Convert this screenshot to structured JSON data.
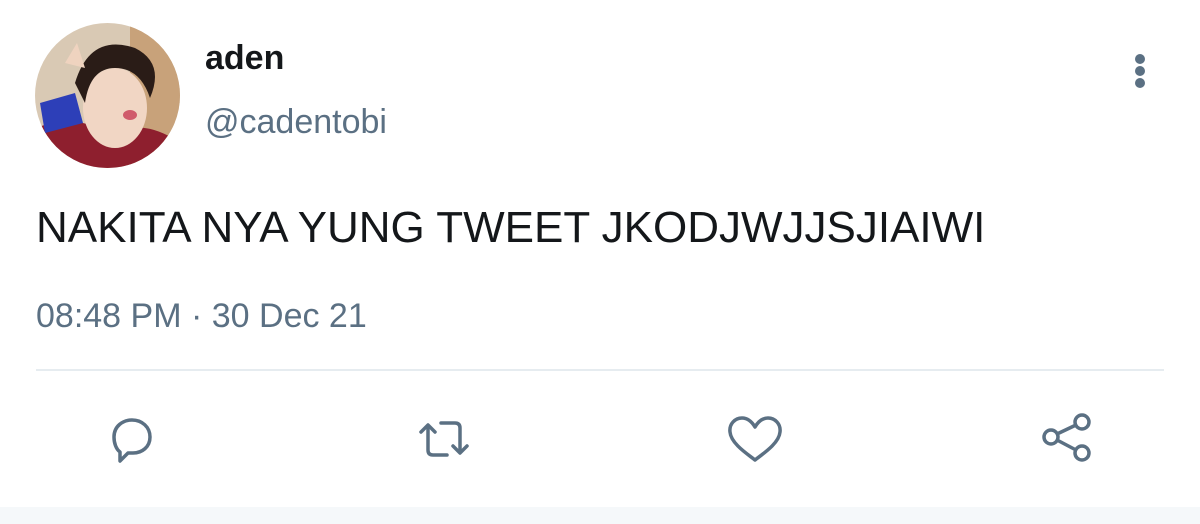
{
  "user": {
    "display_name": "aden",
    "handle": "@cadentobi"
  },
  "tweet": {
    "text": "NAKITA NYA YUNG TWEET JKODJWJJSJIAIWI",
    "time": "08:48 PM",
    "separator": " · ",
    "date": "30 Dec 21"
  },
  "actions": [
    {
      "icon": "reply-icon"
    },
    {
      "icon": "retweet-icon"
    },
    {
      "icon": "like-icon"
    },
    {
      "icon": "share-icon"
    }
  ],
  "colors": {
    "text": "#14171a",
    "secondary": "#5b7083",
    "divider": "#e6ecf0"
  }
}
